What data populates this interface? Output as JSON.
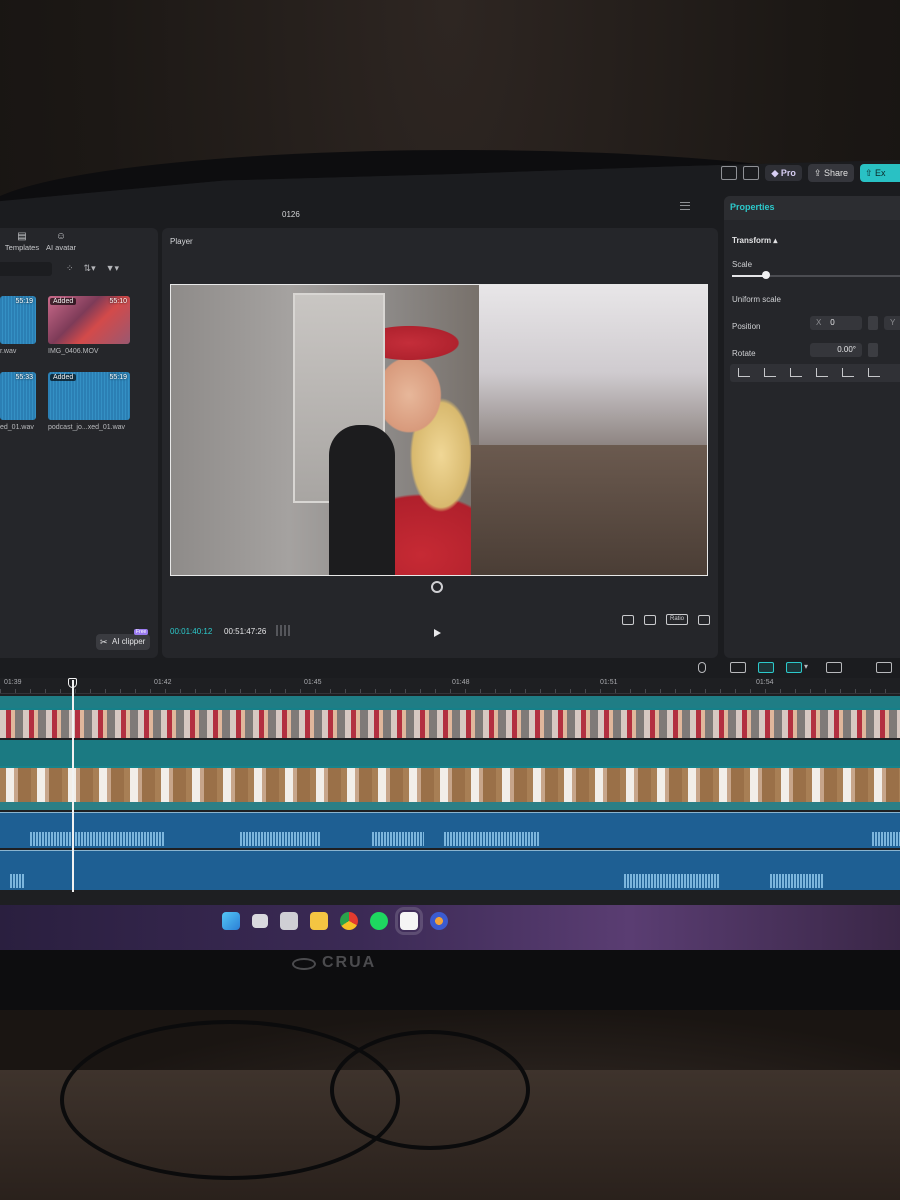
{
  "app": {
    "project_title": "0126",
    "top_actions": {
      "pro_label": "Pro",
      "share_label": "Share",
      "export_label": "Ex"
    }
  },
  "media_panel": {
    "tabs": [
      {
        "label": "Templates",
        "icon": "templates-icon"
      },
      {
        "label": "AI avatar",
        "icon": "avatar-icon"
      }
    ],
    "items": [
      {
        "name": "r.wav",
        "badge": "",
        "duration": "55:19",
        "type": "audio"
      },
      {
        "name": "IMG_0406.MOV",
        "badge": "Added",
        "duration": "55:10",
        "type": "video"
      },
      {
        "name": "ed_01.wav",
        "badge": "",
        "duration": "55:33",
        "type": "audio"
      },
      {
        "name": "podcast_jo...xed_01.wav",
        "badge": "Added",
        "duration": "55:19",
        "type": "audio"
      }
    ],
    "ai_clipper_label": "AI clipper",
    "ai_clipper_tag": "Free"
  },
  "player": {
    "title": "Player",
    "time_current": "00:01:40:12",
    "time_total": "00:51:47:26",
    "ratio_label": "Ratio"
  },
  "properties": {
    "title": "Properties",
    "section": "Transform",
    "scale_label": "Scale",
    "uniform_scale_label": "Uniform scale",
    "position_label": "Position",
    "position_x_label": "X",
    "position_x": "0",
    "position_y_label": "Y",
    "rotate_label": "Rotate",
    "rotate_value": "0.00°",
    "scale_level": 0.2
  },
  "timeline": {
    "ticks": [
      "01:39",
      "01:42",
      "01:45",
      "01:48",
      "01:51",
      "01:54"
    ],
    "playhead_time": "00:01:40:12"
  },
  "taskbar": {
    "apps": [
      "windows-start-icon",
      "task-view-icon",
      "file-explorer-icon",
      "folder-icon",
      "chrome-icon",
      "spotify-icon",
      "capcut-icon",
      "app-icon"
    ]
  },
  "monitor": {
    "brand": "CRUA"
  },
  "colors": {
    "accent": "#2cc9cb",
    "audio_track": "#1e5f93",
    "video_track": "#1b7a82",
    "panel": "#25262a"
  }
}
